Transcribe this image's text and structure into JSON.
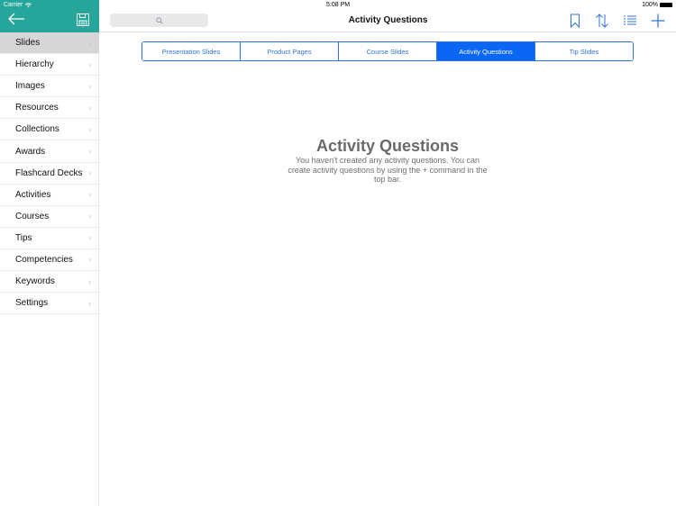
{
  "status_bar": {
    "carrier": "Carrier",
    "time": "5:08 PM",
    "battery": "100%"
  },
  "sidebar": {
    "header_color": "#26a69a",
    "back_icon": "arrow-left-icon",
    "save_icon": "floppy-disk-icon",
    "items": [
      {
        "label": "Slides",
        "active": true
      },
      {
        "label": "Hierarchy"
      },
      {
        "label": "Images"
      },
      {
        "label": "Resources"
      },
      {
        "label": "Collections"
      },
      {
        "label": "Awards"
      },
      {
        "label": "Flashcard Decks"
      },
      {
        "label": "Activities"
      },
      {
        "label": "Courses"
      },
      {
        "label": "Tips"
      },
      {
        "label": "Competencies"
      },
      {
        "label": "Keywords"
      },
      {
        "label": "Settings"
      }
    ],
    "chevron": "›"
  },
  "navbar": {
    "title": "Activity Questions",
    "search_placeholder": "",
    "icons": [
      "bookmark-icon",
      "sort-icon",
      "list-icon",
      "plus-icon"
    ],
    "accent": "#2f73d8"
  },
  "segments": {
    "items": [
      {
        "label": "Presentation Slides"
      },
      {
        "label": "Product Pages"
      },
      {
        "label": "Course Slides"
      },
      {
        "label": "Activity Questions",
        "active": true
      },
      {
        "label": "Tip Slides"
      }
    ],
    "active_color": "#0a66f5"
  },
  "empty_state": {
    "title": "Activity Questions",
    "message": "You haven't created any activity questions. You can create activity questions by using the + command in the top bar."
  }
}
